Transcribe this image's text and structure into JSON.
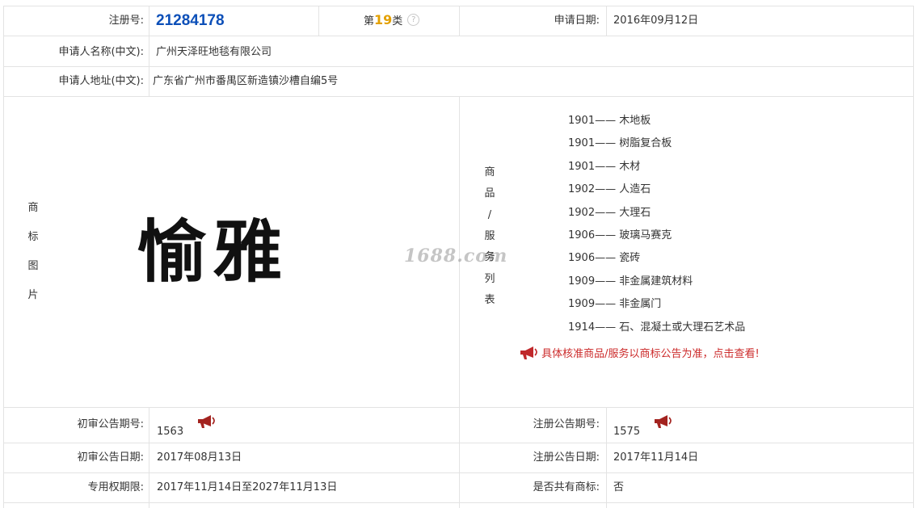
{
  "row1": {
    "reg_label": "注册号:",
    "reg_no": "21284178",
    "class_prefix": "第",
    "class_num": "19",
    "class_suffix": "类",
    "help_icon": "question-circle-icon",
    "date_label": "申请日期:",
    "date_value": "2016年09月12日"
  },
  "applicant": {
    "name_label": "申请人名称(中文):",
    "name_value": "广州天泽旺地毯有限公司",
    "addr_label": "申请人地址(中文):",
    "addr_value": "广东省广州市番禺区新造镇沙槽自编5号"
  },
  "image_section": {
    "label_chars": [
      "商",
      "标",
      "图",
      "片"
    ],
    "trademark_text": "愉雅",
    "watermark": "1688.com"
  },
  "goods_section": {
    "label_chars": [
      "商",
      "品",
      "/",
      "服",
      "务",
      "列",
      "表"
    ],
    "items": [
      {
        "code": "1901——",
        "name": "木地板"
      },
      {
        "code": "1901——",
        "name": "树脂复合板"
      },
      {
        "code": "1901——",
        "name": "木材"
      },
      {
        "code": "1902——",
        "name": "人造石"
      },
      {
        "code": "1902——",
        "name": "大理石"
      },
      {
        "code": "1906——",
        "name": "玻璃马赛克"
      },
      {
        "code": "1906——",
        "name": "瓷砖"
      },
      {
        "code": "1909——",
        "name": "非金属建筑材料"
      },
      {
        "code": "1909——",
        "name": "非金属门"
      },
      {
        "code": "1914——",
        "name": "石、混凝土或大理石艺术品"
      }
    ],
    "notice": "具体核准商品/服务以商标公告为准，点击查看!",
    "notice_icon": "megaphone-icon"
  },
  "announce": {
    "prelim_no_label": "初审公告期号:",
    "prelim_no": "1563",
    "reg_no_label": "注册公告期号:",
    "reg_no": "1575",
    "prelim_date_label": "初审公告日期:",
    "prelim_date": "2017年08月13日",
    "reg_date_label": "注册公告日期:",
    "reg_date": "2017年11月14日",
    "exclusive_label": "专用权期限:",
    "exclusive_value": "2017年11月14日至2027年11月13日",
    "shared_label": "是否共有商标:",
    "shared_value": "否"
  },
  "colors": {
    "reg_no": "#0c4fb8",
    "class_num": "#e3a000",
    "notice": "#cc2b2b",
    "border": "#e3e3e3"
  }
}
